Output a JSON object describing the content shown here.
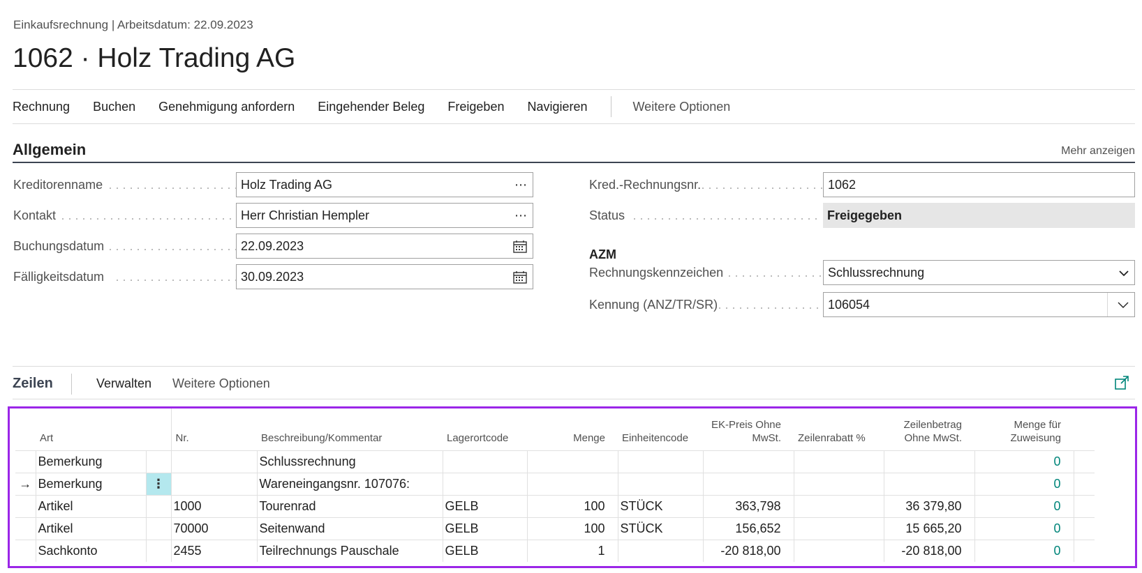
{
  "breadcrumb": "Einkaufsrechnung | Arbeitsdatum: 22.09.2023",
  "title": "1062 · Holz Trading AG",
  "actions": [
    "Rechnung",
    "Buchen",
    "Genehmigung anfordern",
    "Eingehender Beleg",
    "Freigeben",
    "Navigieren"
  ],
  "more_options": "Weitere Optionen",
  "general": {
    "title": "Allgemein",
    "show_more": "Mehr anzeigen",
    "left_fields": [
      {
        "label": "Kreditorenname",
        "value": "Holz Trading AG",
        "icon": "ellipsis-icon"
      },
      {
        "label": "Kontakt",
        "value": "Herr Christian Hempler",
        "icon": "ellipsis-icon"
      },
      {
        "label": "Buchungsdatum",
        "value": "22.09.2023",
        "icon": "calendar-icon"
      },
      {
        "label": "Fälligkeitsdatum",
        "value": "30.09.2023",
        "icon": "calendar-icon"
      }
    ],
    "right_fields": {
      "invoice_no": {
        "label": "Kred.-Rechnungsnr.",
        "value": "1062"
      },
      "status": {
        "label": "Status",
        "value": "Freigegeben"
      },
      "azm": "AZM",
      "invoice_type": {
        "label": "Rechnungskennzeichen",
        "value": "Schlussrechnung"
      },
      "identifier": {
        "label": "Kennung (ANZ/TR/SR)",
        "value": "106054"
      }
    }
  },
  "lines": {
    "title": "Zeilen",
    "manage": "Verwalten",
    "more_options": "Weitere Optionen",
    "columns": {
      "art": "Art",
      "nr": "Nr.",
      "beschreibung": "Beschreibung/Kommentar",
      "lagerort": "Lagerortcode",
      "menge": "Menge",
      "einheit": "Einheitencode",
      "ekpreis": "EK-Preis Ohne MwSt.",
      "rabatt": "Zeilenrabatt %",
      "betrag": "Zeilenbetrag Ohne MwSt.",
      "zuweisung": "Menge für Zuweisung"
    },
    "rows": [
      {
        "art": "Bemerkung",
        "nr": "",
        "beschreibung": "Schlussrechnung",
        "lagerort": "",
        "menge": "",
        "einheit": "",
        "ekpreis": "",
        "rabatt": "",
        "betrag": "",
        "zuweisung": "0"
      },
      {
        "art": "Bemerkung",
        "nr": "",
        "beschreibung": "Wareneingangsnr. 107076:",
        "lagerort": "",
        "menge": "",
        "einheit": "",
        "ekpreis": "",
        "rabatt": "",
        "betrag": "",
        "zuweisung": "0"
      },
      {
        "art": "Artikel",
        "nr": "1000",
        "beschreibung": "Tourenrad",
        "lagerort": "GELB",
        "menge": "100",
        "einheit": "STÜCK",
        "ekpreis": "363,798",
        "rabatt": "",
        "betrag": "36 379,80",
        "zuweisung": "0"
      },
      {
        "art": "Artikel",
        "nr": "70000",
        "beschreibung": "Seitenwand",
        "lagerort": "GELB",
        "menge": "100",
        "einheit": "STÜCK",
        "ekpreis": "156,652",
        "rabatt": "",
        "betrag": "15 665,20",
        "zuweisung": "0"
      },
      {
        "art": "Sachkonto",
        "nr": "2455",
        "beschreibung": "Teilrechnungs Pauschale",
        "lagerort": "GELB",
        "menge": "1",
        "einheit": "",
        "ekpreis": "-20 818,00",
        "rabatt": "",
        "betrag": "-20 818,00",
        "zuweisung": "0"
      }
    ],
    "current_row": 1
  }
}
